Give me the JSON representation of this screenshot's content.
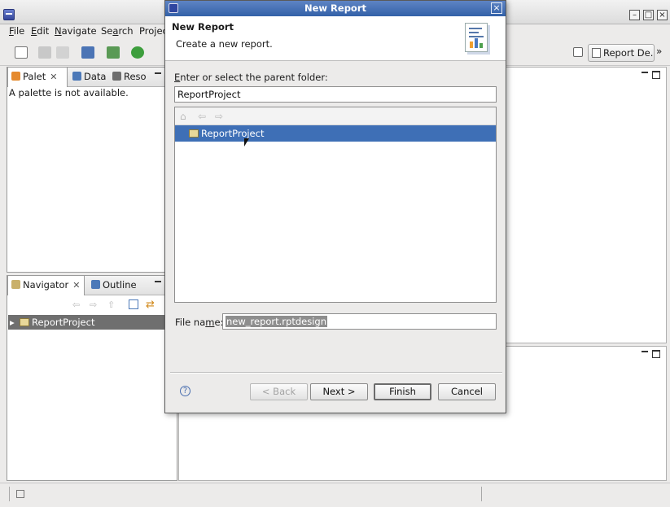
{
  "main_window": {
    "menu": [
      "File",
      "Edit",
      "Navigate",
      "Search",
      "Projec"
    ],
    "perspective_label": "Report De...",
    "overflow_label": "»"
  },
  "palette_panel": {
    "tabs": [
      "Palet",
      "Data",
      "Reso"
    ],
    "message": "A palette is not available."
  },
  "navigator_panel": {
    "tabs": [
      "Navigator",
      "Outline"
    ],
    "project": "ReportProject"
  },
  "dialog": {
    "title": "New Report",
    "close_glyph": "×",
    "wizard_title": "New Report",
    "wizard_description": "Create a new report.",
    "folder_label_accel": "E",
    "folder_label_rest": "nter or select the parent folder:",
    "folder_value": "ReportProject",
    "tree_items": [
      "ReportProject"
    ],
    "filename_label_pre": "File na",
    "filename_label_accel": "m",
    "filename_label_post": "e:",
    "filename_value": "new_report.rptdesign",
    "buttons": {
      "back": "< Back",
      "next": "Next >",
      "finish": "Finish",
      "cancel": "Cancel"
    },
    "help_glyph": "?"
  },
  "colors": {
    "title_gradient_top": "#5e84c4",
    "selection": "#3e6fb6",
    "panel_selection": "#6f6f6f"
  }
}
